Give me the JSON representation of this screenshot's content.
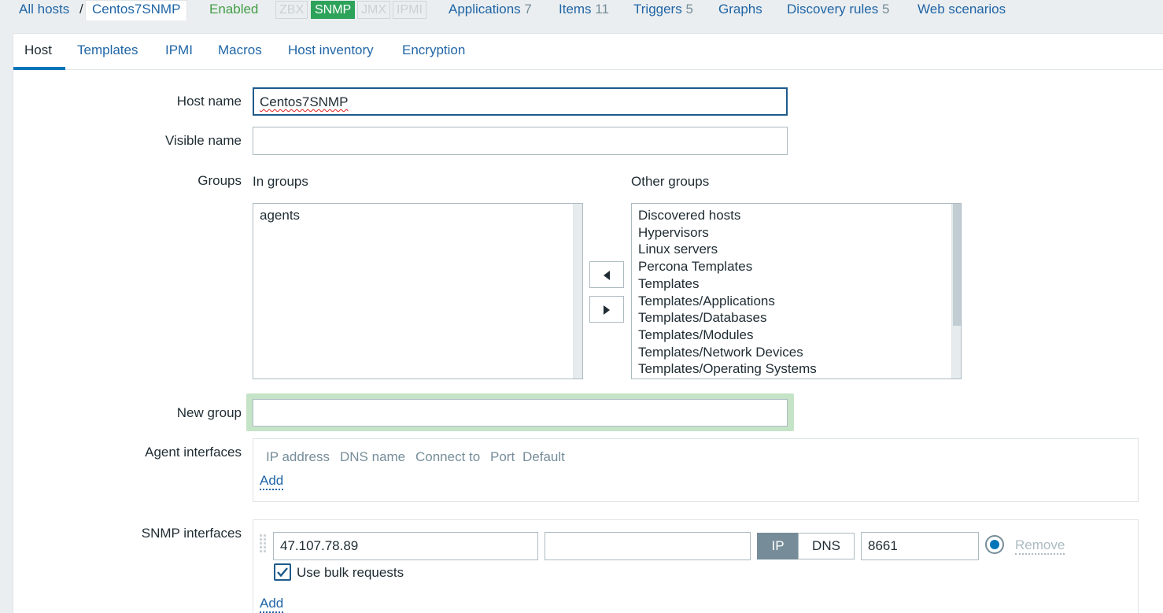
{
  "breadcrumb": {
    "all_hosts": "All hosts",
    "separator": "/",
    "current": "Centos7SNMP"
  },
  "status": "Enabled",
  "availability": [
    {
      "label": "ZBX",
      "active": false
    },
    {
      "label": "SNMP",
      "active": true
    },
    {
      "label": "JMX",
      "active": false
    },
    {
      "label": "IPMI",
      "active": false
    }
  ],
  "nav": {
    "applications": {
      "label": "Applications",
      "count": "7"
    },
    "items": {
      "label": "Items",
      "count": "11"
    },
    "triggers": {
      "label": "Triggers",
      "count": "5"
    },
    "graphs": {
      "label": "Graphs"
    },
    "discovery": {
      "label": "Discovery rules",
      "count": "5"
    },
    "web": {
      "label": "Web scenarios"
    }
  },
  "tabs": [
    "Host",
    "Templates",
    "IPMI",
    "Macros",
    "Host inventory",
    "Encryption"
  ],
  "form": {
    "host_name_label": "Host name",
    "host_name_value": "Centos7SNMP",
    "visible_name_label": "Visible name",
    "visible_name_value": "",
    "groups_label": "Groups",
    "in_groups_label": "In groups",
    "other_groups_label": "Other groups",
    "in_groups": [
      "agents"
    ],
    "other_groups": [
      "Discovered hosts",
      "Hypervisors",
      "Linux servers",
      "Percona Templates",
      "Templates",
      "Templates/Applications",
      "Templates/Databases",
      "Templates/Modules",
      "Templates/Network Devices",
      "Templates/Operating Systems"
    ],
    "new_group_label": "New group",
    "new_group_value": "",
    "agent_interfaces_label": "Agent interfaces",
    "interface_columns": [
      "IP address",
      "DNS name",
      "Connect to",
      "Port",
      "Default"
    ],
    "add_label": "Add",
    "snmp_interfaces_label": "SNMP interfaces",
    "snmp": {
      "ip": "47.107.78.89",
      "dns": "",
      "connect_ip": "IP",
      "connect_dns": "DNS",
      "port": "8661",
      "remove": "Remove",
      "bulk_label": "Use bulk requests",
      "bulk_checked": true
    }
  },
  "colors": {
    "link": "#1f65a6",
    "enabled": "#429e47",
    "snmp_badge": "#2da35a",
    "active_tab_underline": "#0275b8",
    "new_group_highlight": "#c5e3c7"
  }
}
